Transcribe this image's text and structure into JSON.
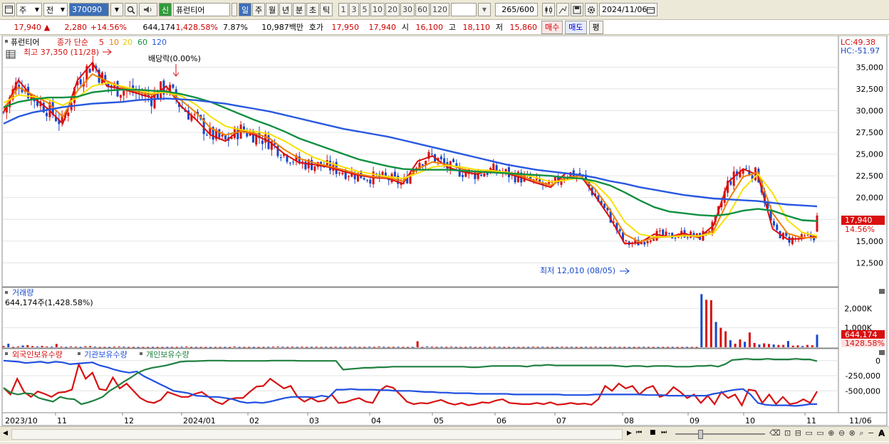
{
  "toolbar": {
    "type_label": "주",
    "prev_label": "전",
    "stock_code": "370090",
    "new_badge": "신",
    "stock_name": "퓨런티어",
    "period_tabs": [
      "일",
      "주",
      "월",
      "년",
      "분",
      "초",
      "틱"
    ],
    "active_period": "일",
    "interval_buttons": [
      "1",
      "3",
      "5",
      "10",
      "20",
      "30",
      "60",
      "120"
    ],
    "count": "265",
    "count_total": "/600",
    "date": "2024/11/06"
  },
  "quote": {
    "price": "17,940",
    "change_arrow": "▲",
    "change": "2,280",
    "change_pct": "+14.56%",
    "volume": "644,174",
    "volume_ratio": "1,428.58%",
    "turnover": "7.87%",
    "amount": "10,987백만",
    "ask_label": "호가",
    "ask1": "17,950",
    "ask2": "17,940",
    "open_label": "시",
    "open": "16,100",
    "high_label": "고",
    "high": "18,110",
    "low_label": "저",
    "low": "15,860",
    "buy_label": "매수",
    "sell_label": "매도",
    "eval_label": "평"
  },
  "colors": {
    "up": "#d81010",
    "down": "#1848c8",
    "ma5": "#d81010",
    "ma10": "#f08000",
    "ma20": "#f8e000",
    "ma60": "#109040",
    "ma120": "#2858e0",
    "foreign": "#d81010",
    "institution": "#2050e0",
    "individual": "#208040"
  },
  "price_panel": {
    "legend_name": "퓨런티어",
    "legend_type": "종가 단순",
    "ma_periods": [
      "5",
      "10",
      "20",
      "60",
      "120"
    ],
    "high_marker": "최고 37,350 (11/28)",
    "low_marker": "최저 12,010 (08/05)",
    "dividend_marker": "배당락(0.00%)",
    "lc_label": "LC:49.38",
    "hc_label": "HC:-51.97",
    "current_price_tag": "17,940",
    "current_pct_tag": "14.56%"
  },
  "volume_panel": {
    "title": "거래량",
    "value_label": "644,174주(1,428.58%)",
    "current_tag": "644,174",
    "current_pct_tag": "1428.58%"
  },
  "holding_panel": {
    "series_labels": [
      "외국인보유수량",
      "기관보유수량",
      "개인보유수량"
    ]
  },
  "x_axis_labels": [
    "2023/10",
    "11",
    "12",
    "2024/01",
    "02",
    "03",
    "04",
    "05",
    "06",
    "07",
    "08",
    "09",
    "10",
    "11",
    "11/06"
  ],
  "chart_data": [
    {
      "type": "line",
      "title": "퓨런티어 종가 단순",
      "series": [
        {
          "name": "5",
          "values": [
            29800,
            33500,
            31500,
            30200,
            28500,
            33500,
            35500,
            32800,
            32500,
            32000,
            31500,
            32800,
            30500,
            29000,
            27200,
            26500,
            27800,
            27200,
            26400,
            25000,
            24000,
            23800,
            23500,
            23000,
            22600,
            22300,
            22200,
            21600,
            24200,
            24800,
            23500,
            23000,
            22700,
            23200,
            22800,
            22300,
            21700,
            21200,
            22800,
            22600,
            20200,
            17700,
            14700,
            14800,
            15800,
            15500,
            15900,
            15400,
            16800,
            21800,
            23300,
            22600,
            16400,
            15200,
            15300,
            15600
          ]
        },
        {
          "name": "10",
          "values": [
            30200,
            32700,
            31800,
            30900,
            29300,
            32300,
            34200,
            33400,
            32700,
            32200,
            31800,
            32300,
            31200,
            29800,
            28000,
            27200,
            27600,
            27400,
            26800,
            25500,
            24500,
            24000,
            23600,
            23200,
            22700,
            22400,
            22300,
            21900,
            23300,
            24100,
            23800,
            23300,
            22900,
            23000,
            22900,
            22500,
            21900,
            21400,
            22300,
            22500,
            21000,
            18600,
            15800,
            14900,
            15400,
            15500,
            15700,
            15500,
            16200,
            19700,
            22400,
            22900,
            18200,
            15900,
            15400,
            15400
          ]
        },
        {
          "name": "20",
          "values": [
            30900,
            31800,
            31600,
            31300,
            30600,
            31500,
            32800,
            33200,
            32800,
            32400,
            32000,
            32100,
            31700,
            30700,
            29300,
            28200,
            27800,
            27600,
            27300,
            26500,
            25500,
            24600,
            24000,
            23500,
            23000,
            22700,
            22400,
            22200,
            22800,
            23500,
            23700,
            23500,
            23200,
            23100,
            22900,
            22700,
            22300,
            21800,
            22000,
            22300,
            21600,
            19900,
            17200,
            15800,
            15500,
            15500,
            15600,
            15600,
            15900,
            18000,
            21000,
            22700,
            20500,
            17400,
            16000,
            15600
          ]
        },
        {
          "name": "60",
          "values": [
            30400,
            31000,
            31300,
            31500,
            31500,
            31600,
            32100,
            32300,
            32400,
            32400,
            32300,
            32200,
            31900,
            31500,
            31000,
            30300,
            29600,
            28900,
            28300,
            27600,
            26800,
            26200,
            25600,
            25000,
            24400,
            24000,
            23600,
            23300,
            23200,
            23200,
            23200,
            23100,
            23000,
            22900,
            22800,
            22700,
            22600,
            22500,
            22300,
            22200,
            21900,
            21400,
            20600,
            19700,
            18900,
            18400,
            18200,
            18000,
            17900,
            18100,
            18500,
            18700,
            18500,
            17900,
            17400,
            17300
          ]
        },
        {
          "name": "120",
          "values": [
            28500,
            29300,
            29800,
            30100,
            30400,
            30600,
            30800,
            30900,
            31000,
            31200,
            31300,
            31400,
            31300,
            31200,
            31000,
            30800,
            30500,
            30200,
            29900,
            29500,
            29100,
            28700,
            28300,
            27900,
            27600,
            27300,
            27000,
            26600,
            26200,
            25800,
            25400,
            25000,
            24600,
            24200,
            23800,
            23500,
            23200,
            23000,
            22800,
            22600,
            22300,
            21900,
            21600,
            21200,
            20900,
            20600,
            20300,
            20100,
            19900,
            19800,
            19700,
            19600,
            19400,
            19200,
            19100,
            19000
          ]
        }
      ],
      "ylim": [
        10000,
        38300
      ],
      "y_ticks": [
        "35,000",
        "32,500",
        "30,000",
        "27,500",
        "25,000",
        "22,500",
        "20,000",
        "17,500",
        "15,000",
        "12,500"
      ],
      "high": 37350,
      "low": 12010,
      "last": 17940
    },
    {
      "type": "bar",
      "title": "거래량",
      "values": [
        60,
        180,
        20,
        40,
        90,
        110,
        60,
        40,
        70,
        40,
        30,
        170,
        30,
        20,
        40,
        30,
        20,
        50,
        60,
        30,
        20,
        20,
        20,
        30,
        40,
        30,
        20,
        20,
        20,
        20,
        20,
        20,
        20,
        20,
        20,
        20,
        20,
        30,
        40,
        20,
        20,
        20,
        20,
        20,
        20,
        20,
        20,
        20,
        40,
        20,
        20,
        20,
        20,
        20,
        20,
        25,
        30,
        40,
        30,
        20,
        30,
        20,
        30,
        20,
        25,
        30,
        20,
        25,
        20,
        30,
        20,
        20,
        25,
        30,
        20,
        20,
        30,
        20,
        40,
        25,
        20,
        20,
        25,
        20,
        20,
        20,
        310,
        20,
        40,
        30,
        20,
        25,
        20,
        30,
        20,
        20,
        20,
        30,
        20,
        20,
        25,
        20,
        30,
        25,
        20,
        20,
        20,
        20,
        20,
        20,
        30,
        20,
        25,
        20,
        20,
        20,
        30,
        20,
        25,
        20,
        20,
        25,
        20,
        30,
        20,
        20,
        20,
        25,
        20,
        20,
        20,
        20,
        20,
        25,
        20,
        20,
        20,
        20,
        20,
        20,
        20,
        20,
        20,
        20,
        20,
        2730,
        2440,
        2420,
        1300,
        1000,
        820,
        360,
        180,
        400,
        280,
        760,
        220,
        140,
        200,
        170,
        140,
        120,
        120,
        320,
        80,
        100,
        60,
        120,
        100,
        644
      ],
      "ylim": [
        0,
        3000000
      ],
      "y_ticks": [
        "2,000K",
        "1,000K"
      ],
      "unit": "K"
    },
    {
      "type": "line",
      "title": "보유수량",
      "series": [
        {
          "name": "외국인보유수량",
          "values": [
            -450000,
            -560000,
            -300000,
            -520000,
            -600000,
            -510000,
            -550000,
            -600000,
            -530000,
            -520000,
            -480000,
            -60000,
            -300000,
            -200000,
            -470000,
            -490000,
            -280000,
            -460000,
            -380000,
            -500000,
            -620000,
            -680000,
            -700000,
            -650000,
            -520000,
            -560000,
            -600000,
            -600000,
            -550000,
            -520000,
            -600000,
            -680000,
            -720000,
            -640000,
            -620000,
            -620000,
            -520000,
            -430000,
            -420000,
            -300000,
            -380000,
            -460000,
            -420000,
            -600000,
            -680000,
            -620000,
            -680000,
            -660000,
            -560000,
            -700000,
            -690000,
            -650000,
            -620000,
            -680000,
            -700000,
            -500000,
            -420000,
            -450000,
            -560000,
            -680000,
            -720000,
            -700000,
            -710000,
            -680000,
            -650000,
            -700000,
            -730000,
            -700000,
            -740000,
            -720000,
            -690000,
            -700000,
            -660000,
            -640000,
            -700000,
            -710000,
            -720000,
            -720000,
            -700000,
            -720000,
            -690000,
            -730000,
            -720000,
            -700000,
            -720000,
            -710000,
            -730000,
            -640000,
            -420000,
            -500000,
            -380000,
            -460000,
            -420000,
            -560000,
            -460000,
            -420000,
            -600000,
            -560000,
            -440000,
            -520000,
            -620000,
            -560000,
            -700000,
            -580000,
            -720000,
            -520000,
            -620000,
            -560000,
            -740000,
            -480000,
            -500000,
            -700000,
            -560000,
            -720000,
            -600000,
            -720000,
            -700000,
            -640000,
            -700000,
            -510000
          ]
        },
        {
          "name": "기관보유수량",
          "values": [
            0,
            -10000,
            -20000,
            -40000,
            -30000,
            -20000,
            -40000,
            -20000,
            -30000,
            -60000,
            -50000,
            -40000,
            -30000,
            -80000,
            -110000,
            -150000,
            -180000,
            -200000,
            -180000,
            -260000,
            -320000,
            -380000,
            -440000,
            -500000,
            -520000,
            -540000,
            -580000,
            -590000,
            -600000,
            -600000,
            -620000,
            -640000,
            -680000,
            -700000,
            -690000,
            -700000,
            -680000,
            -650000,
            -620000,
            -600000,
            -600000,
            -600000,
            -610000,
            -580000,
            -600000,
            -480000,
            -480000,
            -470000,
            -480000,
            -480000,
            -480000,
            -490000,
            -490000,
            -500000,
            -500000,
            -500000,
            -510000,
            -520000,
            -520000,
            -530000,
            -530000,
            -540000,
            -540000,
            -540000,
            -550000,
            -550000,
            -550000,
            -550000,
            -550000,
            -560000,
            -560000,
            -560000,
            -560000,
            -560000,
            -560000,
            -560000,
            -570000,
            -570000,
            -570000,
            -570000,
            -560000,
            -560000,
            -560000,
            -560000,
            -560000,
            -560000,
            -560000,
            -570000,
            -570000,
            -570000,
            -580000,
            -580000,
            -580000,
            -580000,
            -580000,
            -580000,
            -550000,
            -530000,
            -500000,
            -480000,
            -470000,
            -560000,
            -700000,
            -730000,
            -740000,
            -740000,
            -740000,
            -750000,
            -740000,
            -720000,
            -720000
          ]
        },
        {
          "name": "개인보유수량",
          "values": [
            -450000,
            -530000,
            -560000,
            -540000,
            -550000,
            -620000,
            -650000,
            -680000,
            -600000,
            -630000,
            -640000,
            -720000,
            -690000,
            -650000,
            -600000,
            -500000,
            -430000,
            -350000,
            -280000,
            -200000,
            -150000,
            -120000,
            -100000,
            -80000,
            -50000,
            -20000,
            -10000,
            -10000,
            -5000,
            0,
            0,
            0,
            -5000,
            -5000,
            -5000,
            -5000,
            -5000,
            -5000,
            0,
            0,
            0,
            0,
            -5000,
            -5000,
            -5000,
            -5000,
            -5000,
            -5000,
            -150000,
            -140000,
            -130000,
            -120000,
            -120000,
            -110000,
            -110000,
            -100000,
            -100000,
            -100000,
            -100000,
            -100000,
            -100000,
            -100000,
            -100000,
            -100000,
            -100000,
            -100000,
            -110000,
            -110000,
            -100000,
            -90000,
            -90000,
            -90000,
            -90000,
            -90000,
            -100000,
            -80000,
            -80000,
            -70000,
            -80000,
            -80000,
            -80000,
            -80000,
            -80000,
            -80000,
            -80000,
            -80000,
            -80000,
            -90000,
            -100000,
            -90000,
            -90000,
            -100000,
            -90000,
            -90000,
            -90000,
            -100000,
            -100000,
            -100000,
            -90000,
            -90000,
            -80000,
            -100000,
            -60000,
            10000,
            20000,
            30000,
            20000,
            20000,
            30000,
            20000,
            20000,
            20000,
            30000,
            20000,
            20000,
            -10000
          ]
        }
      ],
      "ylim": [
        -850000,
        150000
      ],
      "y_ticks": [
        "0",
        "-250,000",
        "-500,000"
      ]
    }
  ]
}
